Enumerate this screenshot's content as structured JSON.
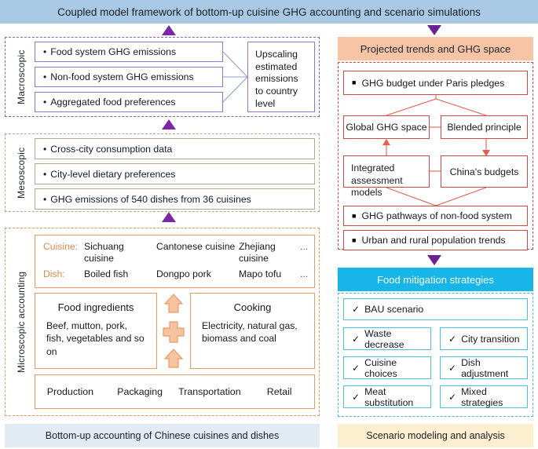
{
  "banner": {
    "title": "Coupled model framework of bottom-up cuisine GHG accounting and scenario simulations"
  },
  "left": {
    "macroscopic": {
      "side_label": "Macroscopic",
      "items": [
        "Food system GHG emissions",
        "Non-food system GHG emissions",
        "Aggregated food preferences"
      ],
      "upscaling": "Upscaling estimated emissions to country level"
    },
    "mesoscopic": {
      "side_label": "Mesoscopic",
      "items": [
        "Cross-city consumption data",
        "City-level dietary preferences",
        "GHG emissions of 540 dishes from 36 cuisines"
      ]
    },
    "microscopic": {
      "side_label": "Microscopic accounting",
      "cuisine_label": "Cuisine:",
      "dish_label": "Dish:",
      "cuisines": [
        "Sichuang cuisine",
        "Cantonese cuisine",
        "Zhejiang cuisine",
        "..."
      ],
      "dishes": [
        "Boiled fish",
        "Dongpo pork",
        "Mapo tofu",
        "..."
      ],
      "ingredients_title": "Food ingredients",
      "ingredients_body": "Beef, mutton, pork, fish, vegetables and so on",
      "cooking_title": "Cooking",
      "cooking_body": "Electricity, natural gas, biomass and coal",
      "stages": [
        "Production",
        "Packaging",
        "Transportation",
        "Retail"
      ]
    },
    "footer": "Bottom-up accounting of Chinese cuisines and dishes"
  },
  "right": {
    "projected": {
      "header": "Projected trends and GHG space",
      "budget": "GHG budget under Paris pledges",
      "global_space": "Global GHG space",
      "blended": "Blended principle",
      "iam": "Integrated assessment models",
      "china": "China's budgets",
      "pathways": "GHG pathways of non-food system",
      "population": "Urban and rural population trends"
    },
    "mitigation": {
      "header": "Food mitigation strategies",
      "bau": "BAU scenario",
      "strategies": [
        "Waste decrease",
        "City transition",
        "Cuisine choices",
        "Dish adjustment",
        "Meat substitution",
        "Mixed strategies"
      ]
    },
    "footer": "Scenario modeling and analysis"
  },
  "icons": {
    "bullet": "•",
    "square": "■",
    "check": "✓"
  },
  "colors": {
    "banner_blue": "#a9c8e3",
    "purple_arrow": "#7b28a8",
    "projected_header": "#f7c5a5",
    "mitigation_header": "#17b5e8",
    "footer_left": "#e2eaf3",
    "footer_right": "#fcefcf",
    "orange": "#ec9a63",
    "red": "#d24a43",
    "cyan": "#4cc0e8"
  }
}
